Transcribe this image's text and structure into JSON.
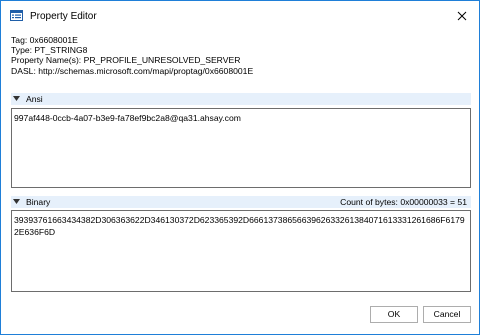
{
  "window": {
    "title": "Property Editor"
  },
  "properties": {
    "tag": "Tag: 0x6608001E",
    "type": "Type: PT_STRING8",
    "names": "Property Name(s): PR_PROFILE_UNRESOLVED_SERVER",
    "dasl": "DASL: http://schemas.microsoft.com/mapi/proptag/0x6608001E"
  },
  "ansi": {
    "label": "Ansi",
    "value": "997af448-0ccb-4a07-b3e9-fa78ef9bc2a8@qa31.ahsay.com"
  },
  "binary": {
    "label": "Binary",
    "count": "Count of bytes: 0x00000033 = 51",
    "value": "39393761663434382D306363622D346130372D623365392D6661373865663962633261384071613331261686F61792E636F6D"
  },
  "buttons": {
    "ok": "OK",
    "cancel": "Cancel"
  },
  "icons": {
    "app": "property-editor-icon",
    "close": "close-icon",
    "collapse": "chevron-down-icon"
  }
}
